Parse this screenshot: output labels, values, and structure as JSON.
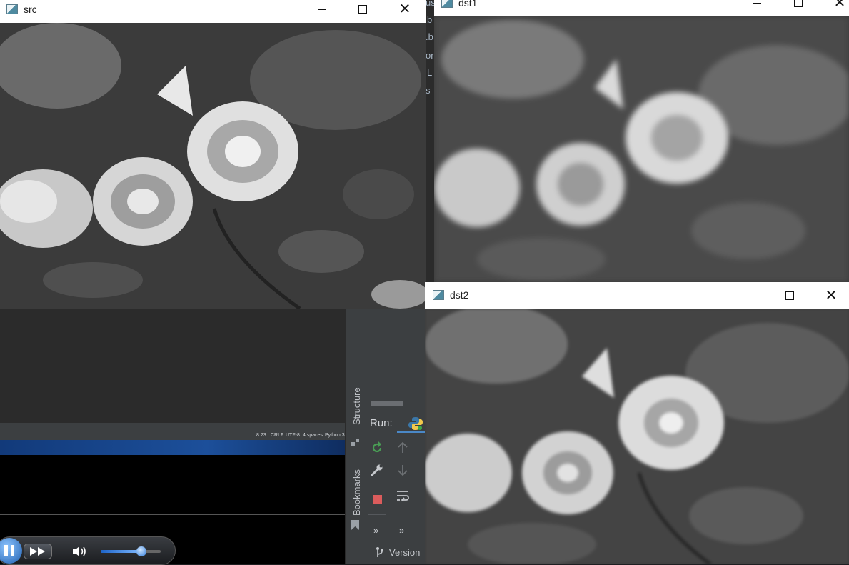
{
  "windows": {
    "src": {
      "title": "src"
    },
    "dst1": {
      "title": "dst1"
    },
    "dst2": {
      "title": "dst2"
    }
  },
  "background_fragments": [
    "us",
    "b",
    ".b",
    "or",
    "L",
    "s"
  ],
  "ide": {
    "status_bar": {
      "position": "8:23",
      "line_sep": "CRLF",
      "encoding": "UTF-8",
      "indent": "4 spaces",
      "interpreter": "Python 3"
    },
    "side_tabs": {
      "structure": "Structure",
      "bookmarks": "Bookmarks"
    },
    "run_label": "Run:",
    "version_label": "Version",
    "more_glyph": "»"
  },
  "media_player": {
    "volume_level": 0.68
  },
  "icons": [
    "window-icon",
    "minimize-icon",
    "maximize-icon",
    "close-icon",
    "python-icon",
    "rerun-icon",
    "wrench-icon",
    "stop-icon",
    "up-arrow-icon",
    "down-arrow-icon",
    "soft-wrap-icon",
    "bookmark-icon",
    "structure-icon",
    "branch-icon",
    "pause-icon",
    "fast-forward-icon",
    "speaker-icon"
  ],
  "colors": {
    "ide_bg": "#2b2b2b",
    "stop_red": "#db5c5c",
    "rerun_green": "#499c54",
    "player_blue": "#1f5fb0"
  }
}
